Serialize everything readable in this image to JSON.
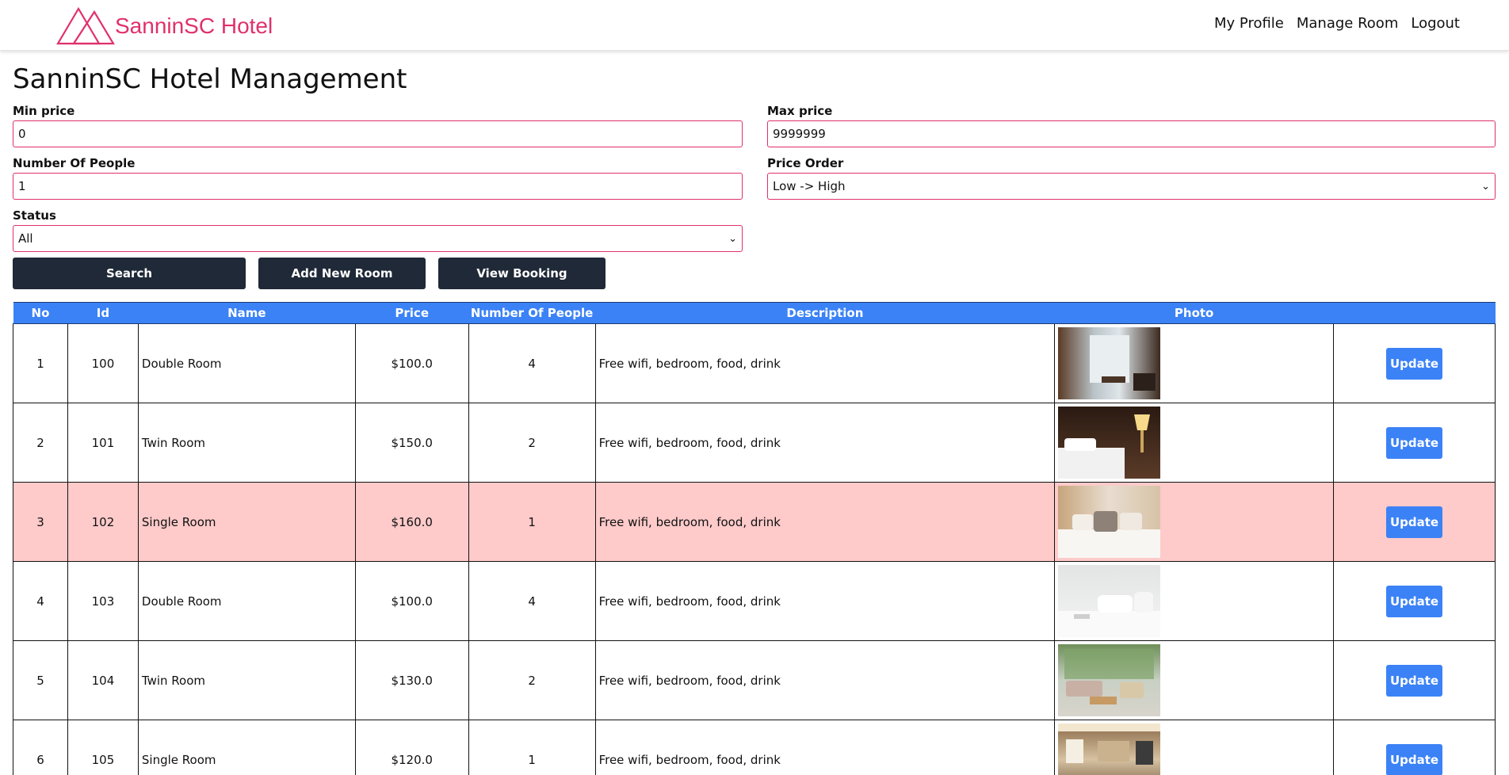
{
  "brand": {
    "name": "SanninSC Hotel",
    "color": "#e0306a"
  },
  "nav": {
    "links": [
      "My Profile",
      "Manage Room",
      "Logout"
    ]
  },
  "page": {
    "title": "SanninSC Hotel Management"
  },
  "filters": {
    "min_price": {
      "label": "Min price",
      "value": "0"
    },
    "max_price": {
      "label": "Max price",
      "value": "9999999"
    },
    "people": {
      "label": "Number Of People",
      "value": "1"
    },
    "price_order": {
      "label": "Price Order",
      "value": "Low -> High"
    },
    "status": {
      "label": "Status",
      "value": "All"
    }
  },
  "actions": {
    "search": "Search",
    "add_room": "Add New Room",
    "view_booking": "View Booking"
  },
  "table": {
    "headers": [
      "No",
      "Id",
      "Name",
      "Price",
      "Number Of People",
      "Description",
      "Photo",
      ""
    ],
    "update_label": "Update",
    "rows": [
      {
        "no": "1",
        "id": "100",
        "name": "Double Room",
        "price": "$100.0",
        "people": "4",
        "description": "Free wifi, bedroom, food, drink",
        "booked": false,
        "photo": "room-photo-window"
      },
      {
        "no": "2",
        "id": "101",
        "name": "Twin Room",
        "price": "$150.0",
        "people": "2",
        "description": "Free wifi, bedroom, food, drink",
        "booked": false,
        "photo": "room-photo-lamp"
      },
      {
        "no": "3",
        "id": "102",
        "name": "Single Room",
        "price": "$160.0",
        "people": "1",
        "description": "Free wifi, bedroom, food, drink",
        "booked": true,
        "photo": "room-photo-pillows"
      },
      {
        "no": "4",
        "id": "103",
        "name": "Double Room",
        "price": "$100.0",
        "people": "4",
        "description": "Free wifi, bedroom, food, drink",
        "booked": false,
        "photo": "room-photo-white-bed"
      },
      {
        "no": "5",
        "id": "104",
        "name": "Twin Room",
        "price": "$130.0",
        "people": "2",
        "description": "Free wifi, bedroom, food, drink",
        "booked": false,
        "photo": "room-photo-lounge"
      },
      {
        "no": "6",
        "id": "105",
        "name": "Single Room",
        "price": "$120.0",
        "people": "1",
        "description": "Free wifi, bedroom, food, drink",
        "booked": false,
        "photo": "room-photo-suite"
      }
    ]
  },
  "colors": {
    "header_blue": "#3b82f6",
    "dark_button": "#1f2937",
    "booked_row": "#fecaca",
    "field_border": "#e0306a"
  }
}
